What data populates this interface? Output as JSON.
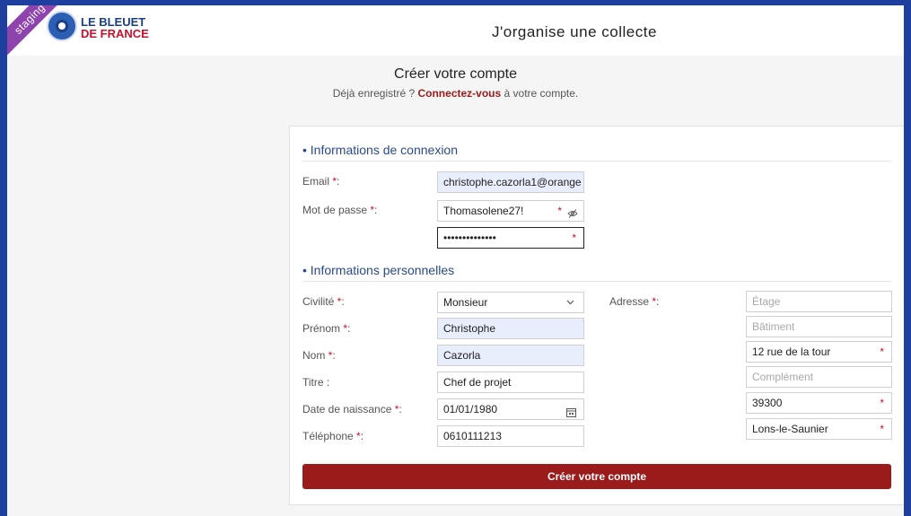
{
  "header": {
    "ribbon": "staging",
    "brand_line1": "LE BLEUET",
    "brand_line2": "DE FRANCE",
    "title": "J'organise une collecte"
  },
  "intro": {
    "title": "Créer votre compte",
    "sub_prefix": "Déjà enregistré ? ",
    "sub_link": "Connectez-vous",
    "sub_suffix": " à votre compte."
  },
  "login": {
    "section": "• Informations de connexion",
    "email_label": "Email ",
    "email_value": "christophe.cazorla1@orange",
    "password_label": "Mot de passe ",
    "password_value": "Thomasolene27!",
    "confirm_value": "••••••••••••••"
  },
  "personal": {
    "section": "• Informations personnelles",
    "civility_label": "Civilité ",
    "civility_value": "Monsieur",
    "firstname_label": "Prénom ",
    "firstname_value": "Christophe",
    "lastname_label": "Nom ",
    "lastname_value": "Cazorla",
    "title_label": "Titre :",
    "title_value": "Chef de projet",
    "birth_label": "Date de naissance ",
    "birth_value": "01/01/1980",
    "phone_label": "Téléphone ",
    "phone_value": "0610111213",
    "address_label": "Adresse ",
    "floor_placeholder": "Étage",
    "building_placeholder": "Bâtiment",
    "street_value": "12 rue de la tour",
    "complement_placeholder": "Complément",
    "zip_value": "39300",
    "city_value": "Lons-le-Saunier"
  },
  "required_mark": "*",
  "colon": ":",
  "submit_label": "Créer votre compte",
  "icons": {
    "eye": "eye-off-icon",
    "chevron": "chevron-down-icon",
    "calendar": "calendar-icon"
  },
  "colors": {
    "background": "#1f3f9e",
    "brand_blue": "#1a3f88",
    "brand_red": "#c8102e",
    "submit": "#9b1b1b",
    "ribbon": "#8e44ad",
    "autofill": "#e8eefc"
  }
}
